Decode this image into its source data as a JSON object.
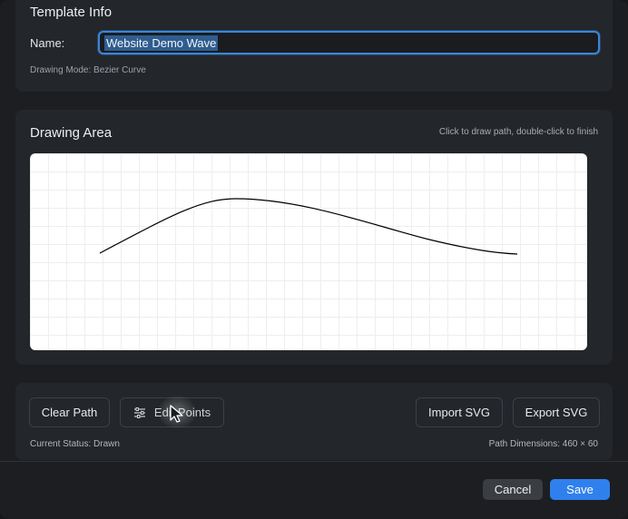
{
  "template_info": {
    "title": "Template Info",
    "name_label": "Name:",
    "name_value": "Website Demo Wave",
    "drawing_mode": "Drawing Mode: Bezier Curve"
  },
  "drawing_area": {
    "title": "Drawing Area",
    "hint": "Click to draw path, double-click to finish",
    "canvas_background": "#ffffff",
    "path_color": "#000000"
  },
  "controls": {
    "clear_label": "Clear Path",
    "edit_label": "Edit Points",
    "edit_icon": "sliders-icon",
    "import_label": "Import SVG",
    "export_label": "Export SVG",
    "status": "Current Status: Drawn",
    "dimensions": "Path Dimensions: 460 × 60"
  },
  "footer": {
    "cancel_label": "Cancel",
    "save_label": "Save",
    "accent": "#2f80ed"
  }
}
